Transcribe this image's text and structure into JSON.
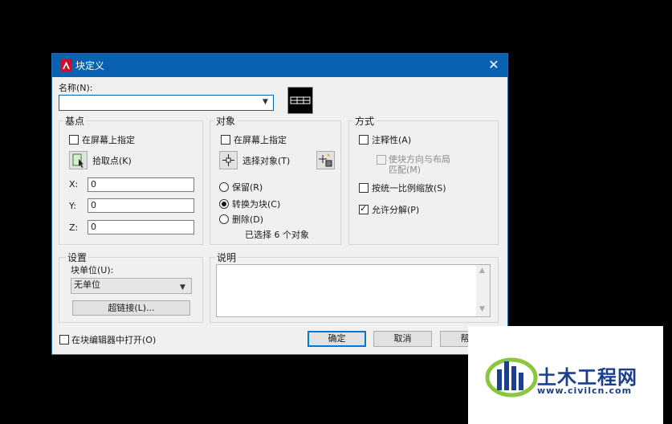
{
  "dialog": {
    "title": "块定义",
    "name_label": "名称(N):",
    "name_value": "",
    "ok": "确定",
    "cancel": "取消",
    "help": "帮助",
    "open_in_editor": "在块编辑器中打开(O)"
  },
  "base_point": {
    "title": "基点",
    "specify_on_screen": "在屏幕上指定",
    "pick_point": "拾取点(K)",
    "x_label": "X:",
    "y_label": "Y:",
    "z_label": "Z:",
    "x": "0",
    "y": "0",
    "z": "0"
  },
  "objects": {
    "title": "对象",
    "specify_on_screen": "在屏幕上指定",
    "select_objects": "选择对象(T)",
    "retain": "保留(R)",
    "convert_to_block": "转换为块(C)",
    "delete": "删除(D)",
    "selected_count": "已选择 6 个对象"
  },
  "behavior": {
    "title": "方式",
    "annotative": "注释性(A)",
    "match_orientation": "使块方向与布局",
    "match_orientation_2": "匹配(M)",
    "scale_uniformly": "按统一比例缩放(S)",
    "allow_exploding": "允许分解(P)"
  },
  "settings": {
    "title": "设置",
    "block_unit_label": "块单位(U):",
    "block_unit_value": "无单位",
    "hyperlink": "超链接(L)..."
  },
  "description": {
    "title": "说明"
  },
  "watermark": {
    "main": "土木工程网",
    "sub": "www.civilcn.com"
  },
  "colors": {
    "titlebar": "#0b61b1",
    "logo_blue": "#1c3f8d",
    "logo_green": "#8cc63f"
  }
}
